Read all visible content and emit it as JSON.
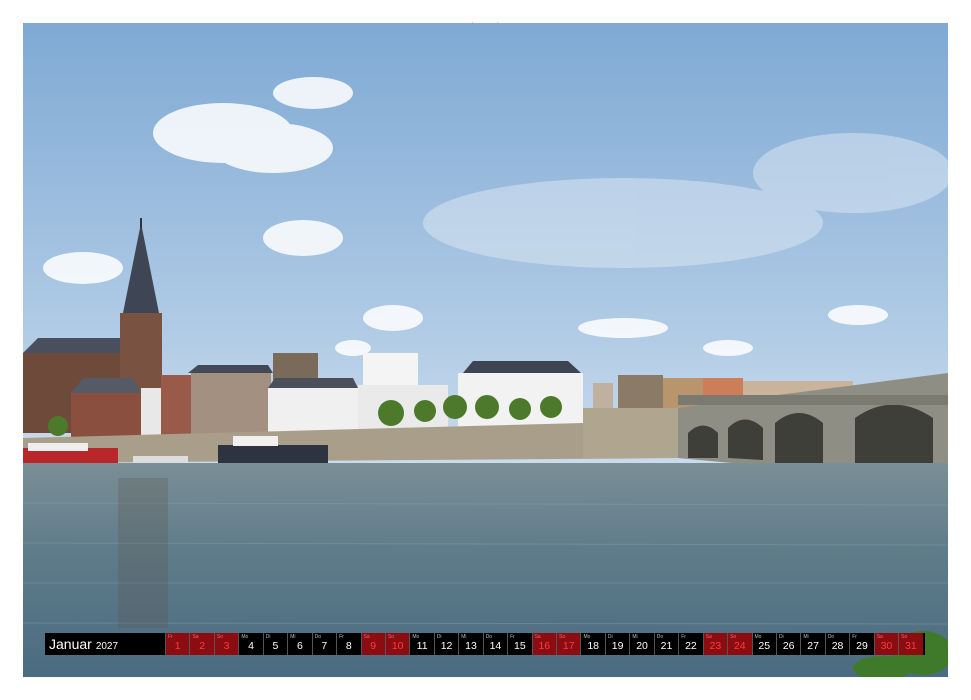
{
  "calendar": {
    "month": "Januar",
    "year": "2027",
    "days": [
      {
        "dn": "Fr",
        "d": "1",
        "red": true
      },
      {
        "dn": "Sa",
        "d": "2",
        "red": true
      },
      {
        "dn": "So",
        "d": "3",
        "red": true
      },
      {
        "dn": "Mo",
        "d": "4",
        "red": false
      },
      {
        "dn": "Di",
        "d": "5",
        "red": false
      },
      {
        "dn": "Mi",
        "d": "6",
        "red": false
      },
      {
        "dn": "Do",
        "d": "7",
        "red": false
      },
      {
        "dn": "Fr",
        "d": "8",
        "red": false
      },
      {
        "dn": "Sa",
        "d": "9",
        "red": true
      },
      {
        "dn": "So",
        "d": "10",
        "red": true
      },
      {
        "dn": "Mo",
        "d": "11",
        "red": false
      },
      {
        "dn": "Di",
        "d": "12",
        "red": false
      },
      {
        "dn": "Mi",
        "d": "13",
        "red": false
      },
      {
        "dn": "Do",
        "d": "14",
        "red": false
      },
      {
        "dn": "Fr",
        "d": "15",
        "red": false
      },
      {
        "dn": "Sa",
        "d": "16",
        "red": true
      },
      {
        "dn": "So",
        "d": "17",
        "red": true
      },
      {
        "dn": "Mo",
        "d": "18",
        "red": false
      },
      {
        "dn": "Di",
        "d": "19",
        "red": false
      },
      {
        "dn": "Mi",
        "d": "20",
        "red": false
      },
      {
        "dn": "Do",
        "d": "21",
        "red": false
      },
      {
        "dn": "Fr",
        "d": "22",
        "red": false
      },
      {
        "dn": "Sa",
        "d": "23",
        "red": true
      },
      {
        "dn": "So",
        "d": "24",
        "red": true
      },
      {
        "dn": "Mo",
        "d": "25",
        "red": false
      },
      {
        "dn": "Di",
        "d": "26",
        "red": false
      },
      {
        "dn": "Mi",
        "d": "27",
        "red": false
      },
      {
        "dn": "Do",
        "d": "28",
        "red": false
      },
      {
        "dn": "Fr",
        "d": "29",
        "red": false
      },
      {
        "dn": "Sa",
        "d": "30",
        "red": true
      },
      {
        "dn": "So",
        "d": "31",
        "red": true
      }
    ]
  },
  "colors": {
    "bar": "#000000",
    "weekend": "#8b0d12",
    "weekend_text": "#ff3b3b",
    "sky": "#8fb6dc",
    "water": "#5c7a8c"
  }
}
